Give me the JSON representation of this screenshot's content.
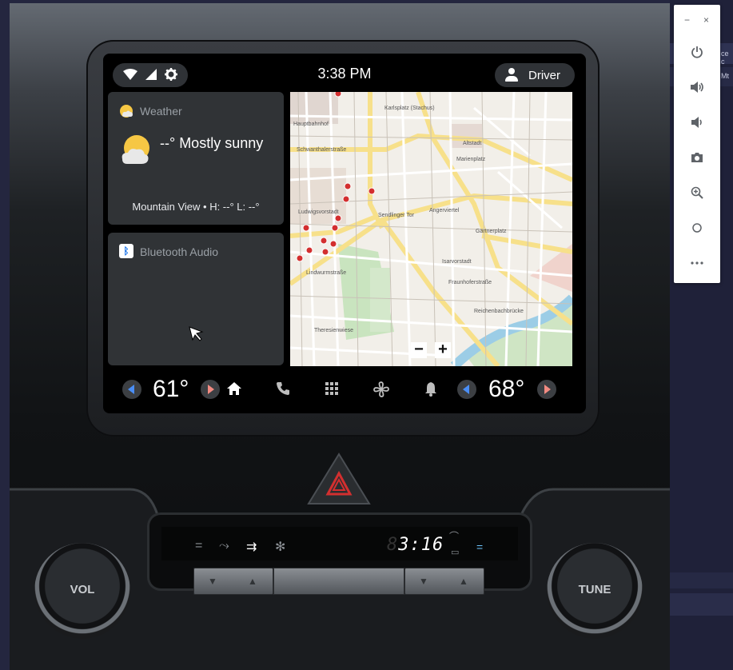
{
  "status_bar": {
    "icons": [
      "wifi-icon",
      "signal-icon",
      "settings-icon"
    ],
    "time": "3:38 PM",
    "profile": {
      "icon": "person-icon",
      "label": "Driver"
    }
  },
  "weather_card": {
    "title": "Weather",
    "condition": "--° Mostly sunny",
    "details": "Mountain View • H: --° L: --°"
  },
  "media_card": {
    "title": "Bluetooth Audio"
  },
  "map": {
    "zoom_out_label": "−",
    "zoom_in_label": "+",
    "labels": [
      "Karlsplatz (Stachus)",
      "Hauptbahnhof",
      "Altstadt",
      "Marienplatz",
      "Angerviertel",
      "Gärtnerplatz",
      "Isarvorstadt",
      "Fraunhoferstraße",
      "Reichenbachbrücke",
      "Sendlinger Tor",
      "Schwanthalerstraße",
      "Lindwurmstraße",
      "Theresienwiese",
      "Ludwigsvorstadt"
    ]
  },
  "nav_bar": {
    "left_temp": "61°",
    "right_temp": "68°",
    "icons": [
      "home-icon",
      "phone-icon",
      "apps-grid-icon",
      "fan-icon",
      "notifications-icon"
    ]
  },
  "console": {
    "clock_dim": "8",
    "clock": "3:16",
    "vol_label": "VOL",
    "tune_label": "TUNE"
  },
  "emulator_panel": {
    "minimize": "−",
    "close": "×",
    "buttons": [
      "power-icon",
      "volume-up-icon",
      "volume-down-icon",
      "camera-icon",
      "zoom-icon",
      "circle-home-icon",
      "more-icon"
    ]
  },
  "background_window": {
    "text_a": "ce c",
    "text_b": "Mt"
  },
  "colors": {
    "screen_bg": "#000000",
    "card_bg": "#303336",
    "accent_sun": "#f6c744",
    "hazard_red": "#d32f2f"
  }
}
